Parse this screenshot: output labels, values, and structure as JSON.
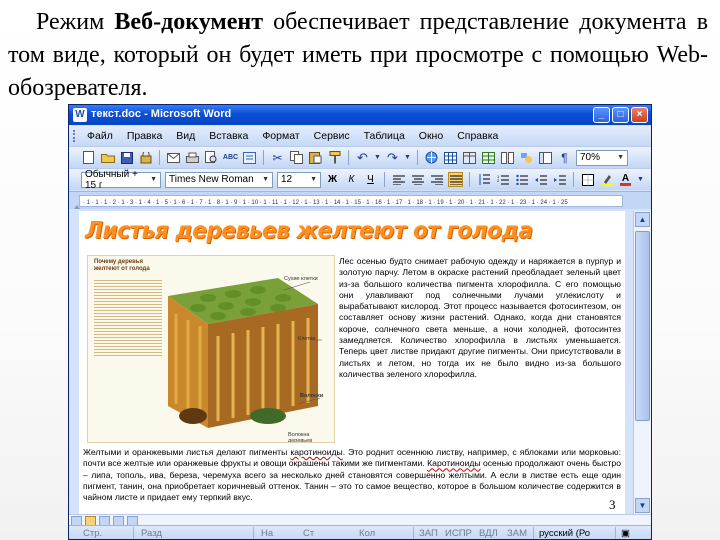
{
  "caption": {
    "lead": "Режим",
    "bold": "Веб-документ",
    "rest": "обеспечивает представление документа в том виде, который он будет иметь при просмотре с помощью Web-обозревателя."
  },
  "window": {
    "title": "текст.doc - Microsoft Word",
    "app_icon": "W",
    "buttons": {
      "minimize": "_",
      "maximize": "□",
      "close": "×"
    }
  },
  "menu": {
    "items": [
      "Файл",
      "Правка",
      "Вид",
      "Вставка",
      "Формат",
      "Сервис",
      "Таблица",
      "Окно",
      "Справка"
    ]
  },
  "toolbar_standard": {
    "icons": [
      "new-document-icon",
      "open-folder-icon",
      "save-icon",
      "permission-icon",
      "email-icon",
      "print-icon",
      "print-preview-icon",
      "spelling-icon",
      "research-icon",
      "cut-icon",
      "copy-icon",
      "paste-icon",
      "format-painter-icon",
      "undo-icon",
      "redo-icon",
      "hyperlink-icon",
      "tables-borders-icon",
      "insert-table-icon",
      "excel-sheet-icon",
      "columns-icon",
      "drawing-icon",
      "document-map-icon",
      "show-formatting-icon"
    ],
    "zoom": "70%",
    "show_formatting_glyph": "¶"
  },
  "toolbar_format": {
    "style": "Обычный + 15 г",
    "font": "Times New Roman",
    "size": "12",
    "bold": "Ж",
    "italic": "К",
    "underline": "Ч",
    "font_color_letter": "A"
  },
  "document": {
    "heading": "Листья деревьев желтеют от голода",
    "figure": {
      "caption": "Почему деревья желтеют от голода",
      "labels": [
        "Сухие клетки",
        "Клетки",
        "Волоски",
        "Волокна деревьев"
      ]
    },
    "right_column": "Лес осенью будто снимает рабочую одежду и наряжается в пурпур и золотую парчу. Летом в окраске растений преобладает зеленый цвет из-за большого количества пигмента хлорофилла. С его помощью они улавливают под солнечными лучами углекислоту и вырабатывают кислород. Этот процесс называется фотосинтезом, он составляет основу жизни растений. Однако, когда дни становятся короче, солнечного света меньше, а ночи холодней, фотосинтез замедляется. Количество хлорофилла в листьях уменьшается. Теперь цвет листве придают другие пигменты. Они присутствовали в листьях и летом, но тогда их не было видно из-за большого количества зеленого хлорофилла.",
    "full_width_pre": "Желтыми и оранжевыми листья делают пигменты ",
    "full_width_u1": "каротиноиды",
    "full_width_mid": ". Это роднит осеннюю листву, например, с яблоками или морковью: почти все желтые или оранжевые фрукты и овощи окрашены такими же пигментами. ",
    "full_width_u2": "Каротиноиды",
    "full_width_post": " осенью продолжают очень быстро – липа, тополь, ива, береза, черемуха всего за несколько дней становятся совершенно желтыми. А если в листве есть еще один пигмент, танин, она приобретает коричневый оттенок. Танин – это то самое вещество, которое в большом количестве содержится в чайном листе и придает ему терпкий вкус."
  },
  "slide_number": "3",
  "status": {
    "page": "Стр.",
    "section": "Разд",
    "at": "На",
    "line": "Ст",
    "col": "Кол",
    "rec": "ЗАП",
    "trk": "ИСПР",
    "ext": "ВДЛ",
    "ovr": "ЗАМ",
    "lang": "русский (Ро"
  }
}
